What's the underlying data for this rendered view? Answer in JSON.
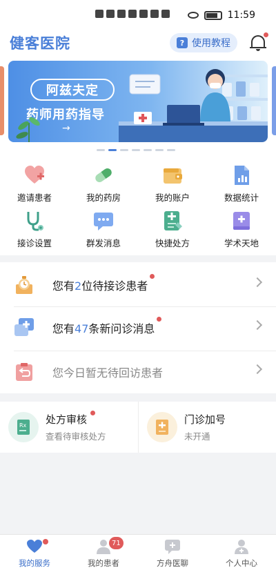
{
  "status_bar": {
    "time": "11:59"
  },
  "header": {
    "app_title": "健客医院",
    "tutorial_label": "使用教程"
  },
  "banner": {
    "title": "阿兹夫定",
    "subtitle": "药师用药指导",
    "arrow": "→",
    "active_slide": 1,
    "slide_count": 7
  },
  "grid": {
    "items": [
      {
        "label": "邀请患者",
        "icon": "heart-plus-icon",
        "color": "#e88a8a"
      },
      {
        "label": "我的药房",
        "icon": "pill-icon",
        "color": "#8fcf9f"
      },
      {
        "label": "我的账户",
        "icon": "wallet-icon",
        "color": "#f0b75a"
      },
      {
        "label": "数据统计",
        "icon": "bar-chart-icon",
        "color": "#6f9ee8"
      },
      {
        "label": "接诊设置",
        "icon": "stethoscope-icon",
        "color": "#52b39a"
      },
      {
        "label": "群发消息",
        "icon": "message-icon",
        "color": "#6f9ee8"
      },
      {
        "label": "快捷处方",
        "icon": "prescription-icon",
        "color": "#52b39a"
      },
      {
        "label": "学术天地",
        "icon": "book-icon",
        "color": "#8c7fe0"
      }
    ]
  },
  "notifications": {
    "pending_patients": {
      "prefix": "您有",
      "count": "2",
      "suffix": "位待接诊患者"
    },
    "new_messages": {
      "prefix": "您有",
      "count": "47",
      "suffix": "条新问诊消息"
    },
    "followups": {
      "text": "您今日暂无待回访患者"
    }
  },
  "cards": {
    "prescription_review": {
      "title": "处方审核",
      "sub": "查看待审核处方"
    },
    "extra_appointment": {
      "title": "门诊加号",
      "sub": "未开通"
    }
  },
  "tabbar": {
    "tabs": [
      {
        "label": "我的服务"
      },
      {
        "label": "我的患者",
        "badge": "71"
      },
      {
        "label": "方舟医聊"
      },
      {
        "label": "个人中心"
      }
    ]
  },
  "colors": {
    "accent": "#4a7fd8",
    "badge_red": "#e05a5a"
  }
}
